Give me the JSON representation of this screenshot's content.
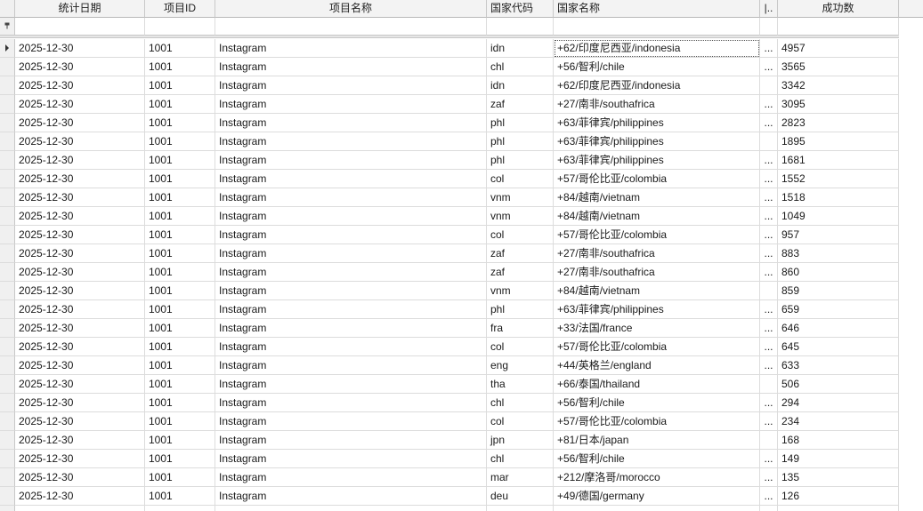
{
  "columns": [
    "统计日期",
    "项目ID",
    "项目名称",
    "国家代码",
    "国家名称",
    "|..",
    "成功数"
  ],
  "filter_row_icon": "pin-filter-icon",
  "rows": [
    {
      "date": "2025-12-30",
      "pid": "1001",
      "pname": "Instagram",
      "code": "idn",
      "country": "+62/印度尼西亚/indonesia",
      "more": "...",
      "success": "4957"
    },
    {
      "date": "2025-12-30",
      "pid": "1001",
      "pname": "Instagram",
      "code": "chl",
      "country": "+56/智利/chile",
      "more": "...",
      "success": "3565"
    },
    {
      "date": "2025-12-30",
      "pid": "1001",
      "pname": "Instagram",
      "code": "idn",
      "country": "+62/印度尼西亚/indonesia",
      "more": "",
      "success": "3342"
    },
    {
      "date": "2025-12-30",
      "pid": "1001",
      "pname": "Instagram",
      "code": "zaf",
      "country": "+27/南非/southafrica",
      "more": "...",
      "success": "3095"
    },
    {
      "date": "2025-12-30",
      "pid": "1001",
      "pname": "Instagram",
      "code": "phl",
      "country": "+63/菲律宾/philippines",
      "more": "...",
      "success": "2823"
    },
    {
      "date": "2025-12-30",
      "pid": "1001",
      "pname": "Instagram",
      "code": "phl",
      "country": "+63/菲律宾/philippines",
      "more": "",
      "success": "1895"
    },
    {
      "date": "2025-12-30",
      "pid": "1001",
      "pname": "Instagram",
      "code": "phl",
      "country": "+63/菲律宾/philippines",
      "more": "...",
      "success": "1681"
    },
    {
      "date": "2025-12-30",
      "pid": "1001",
      "pname": "Instagram",
      "code": "col",
      "country": "+57/哥伦比亚/colombia",
      "more": "...",
      "success": "1552"
    },
    {
      "date": "2025-12-30",
      "pid": "1001",
      "pname": "Instagram",
      "code": "vnm",
      "country": "+84/越南/vietnam",
      "more": "...",
      "success": "1518"
    },
    {
      "date": "2025-12-30",
      "pid": "1001",
      "pname": "Instagram",
      "code": "vnm",
      "country": "+84/越南/vietnam",
      "more": "...",
      "success": "1049"
    },
    {
      "date": "2025-12-30",
      "pid": "1001",
      "pname": "Instagram",
      "code": "col",
      "country": "+57/哥伦比亚/colombia",
      "more": "...",
      "success": "957"
    },
    {
      "date": "2025-12-30",
      "pid": "1001",
      "pname": "Instagram",
      "code": "zaf",
      "country": "+27/南非/southafrica",
      "more": "...",
      "success": "883"
    },
    {
      "date": "2025-12-30",
      "pid": "1001",
      "pname": "Instagram",
      "code": "zaf",
      "country": "+27/南非/southafrica",
      "more": "...",
      "success": "860"
    },
    {
      "date": "2025-12-30",
      "pid": "1001",
      "pname": "Instagram",
      "code": "vnm",
      "country": "+84/越南/vietnam",
      "more": "",
      "success": "859"
    },
    {
      "date": "2025-12-30",
      "pid": "1001",
      "pname": "Instagram",
      "code": "phl",
      "country": "+63/菲律宾/philippines",
      "more": "...",
      "success": "659"
    },
    {
      "date": "2025-12-30",
      "pid": "1001",
      "pname": "Instagram",
      "code": "fra",
      "country": "+33/法国/france",
      "more": "...",
      "success": "646"
    },
    {
      "date": "2025-12-30",
      "pid": "1001",
      "pname": "Instagram",
      "code": "col",
      "country": "+57/哥伦比亚/colombia",
      "more": "...",
      "success": "645"
    },
    {
      "date": "2025-12-30",
      "pid": "1001",
      "pname": "Instagram",
      "code": "eng",
      "country": "+44/英格兰/england",
      "more": "...",
      "success": "633"
    },
    {
      "date": "2025-12-30",
      "pid": "1001",
      "pname": "Instagram",
      "code": "tha",
      "country": "+66/泰国/thailand",
      "more": "",
      "success": "506"
    },
    {
      "date": "2025-12-30",
      "pid": "1001",
      "pname": "Instagram",
      "code": "chl",
      "country": "+56/智利/chile",
      "more": "...",
      "success": "294"
    },
    {
      "date": "2025-12-30",
      "pid": "1001",
      "pname": "Instagram",
      "code": "col",
      "country": "+57/哥伦比亚/colombia",
      "more": "...",
      "success": "234"
    },
    {
      "date": "2025-12-30",
      "pid": "1001",
      "pname": "Instagram",
      "code": "jpn",
      "country": "+81/日本/japan",
      "more": "",
      "success": "168"
    },
    {
      "date": "2025-12-30",
      "pid": "1001",
      "pname": "Instagram",
      "code": "chl",
      "country": "+56/智利/chile",
      "more": "...",
      "success": "149"
    },
    {
      "date": "2025-12-30",
      "pid": "1001",
      "pname": "Instagram",
      "code": "mar",
      "country": "+212/摩洛哥/morocco",
      "more": "...",
      "success": "135"
    },
    {
      "date": "2025-12-30",
      "pid": "1001",
      "pname": "Instagram",
      "code": "deu",
      "country": "+49/德国/germany",
      "more": "...",
      "success": "126"
    }
  ]
}
